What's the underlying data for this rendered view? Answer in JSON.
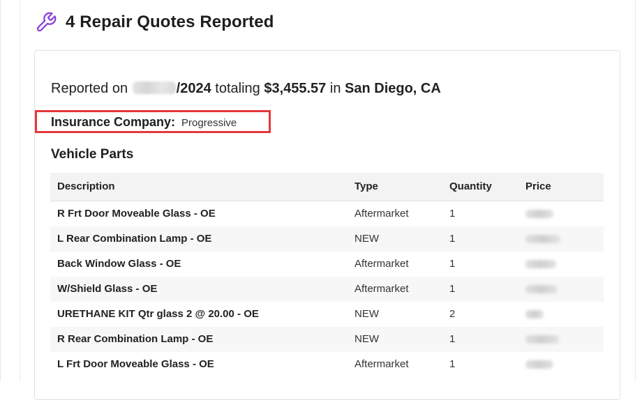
{
  "header": {
    "title": "4 Repair Quotes Reported",
    "icon": "wrench-icon",
    "icon_color": "#8b3fd9"
  },
  "report": {
    "prefix": "Reported on",
    "date_suffix": "/2024",
    "totaling_word": "totaling",
    "total": "$3,455.57",
    "in_word": "in",
    "location": "San Diego, CA"
  },
  "insurance": {
    "label": "Insurance Company:",
    "value": "Progressive",
    "highlight_color": "#e5383b"
  },
  "vehicle_parts": {
    "title": "Vehicle Parts",
    "columns": [
      "Description",
      "Type",
      "Quantity",
      "Price"
    ],
    "rows": [
      {
        "description": "R Frt Door Moveable Glass - OE",
        "type": "Aftermarket",
        "quantity": "1"
      },
      {
        "description": "L Rear Combination Lamp - OE",
        "type": "NEW",
        "quantity": "1"
      },
      {
        "description": "Back Window Glass - OE",
        "type": "Aftermarket",
        "quantity": "1"
      },
      {
        "description": "W/Shield Glass - OE",
        "type": "Aftermarket",
        "quantity": "1"
      },
      {
        "description": "URETHANE KIT Qtr glass 2 @ 20.00 - OE",
        "type": "NEW",
        "quantity": "2"
      },
      {
        "description": "R Rear Combination Lamp - OE",
        "type": "NEW",
        "quantity": "1"
      },
      {
        "description": "L Frt Door Moveable Glass - OE",
        "type": "Aftermarket",
        "quantity": "1"
      }
    ]
  }
}
